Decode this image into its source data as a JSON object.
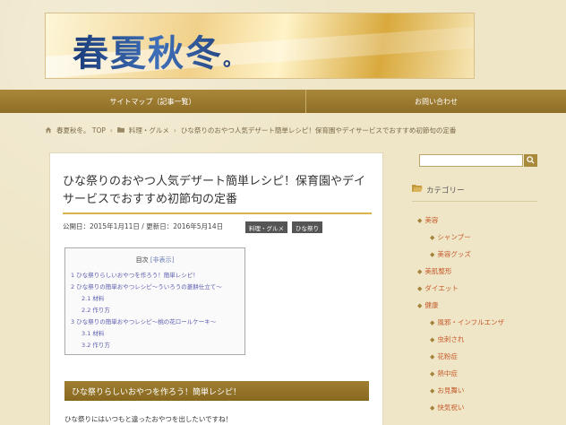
{
  "header": {
    "site_title": "春夏秋冬",
    "title_mark": "。"
  },
  "nav": {
    "items": [
      {
        "label": "サイトマップ（記事一覧）"
      },
      {
        "label": "お問い合わせ"
      }
    ]
  },
  "breadcrumb": {
    "home": "春夏秋冬。 TOP",
    "category": "料理・グルメ",
    "current": "ひな祭りのおやつ人気デザート簡単レシピ！保育園やデイサービスでおすすめ初節句の定番",
    "separator": "›"
  },
  "article": {
    "title": "ひな祭りのおやつ人気デザート簡単レシピ！保育園やデイサービスでおすすめ初節句の定番",
    "meta": "公開日：2015年1月11日 / 更新日：2016年5月14日",
    "tags": [
      "料理・グルメ",
      "ひな祭り"
    ],
    "toc": {
      "heading": "目次",
      "toggle": "[非表示]",
      "items": [
        {
          "text": "1 ひな祭りらしいおやつを作ろう！簡単レシピ！",
          "level": 1
        },
        {
          "text": "2 ひな祭りの簡単おやつレシピ〜ういろうの菱餅仕立て〜",
          "level": 1
        },
        {
          "text": "2.1 材料",
          "level": 2
        },
        {
          "text": "2.2 作り方",
          "level": 2
        },
        {
          "text": "3 ひな祭りの簡単おやつレシピ〜桃の花ロールケーキ〜",
          "level": 1
        },
        {
          "text": "3.1 材料",
          "level": 2
        },
        {
          "text": "3.2 作り方",
          "level": 2
        }
      ]
    },
    "section_heading": "ひな祭りらしいおやつを作ろう！簡単レシピ！",
    "section_text": "ひな祭りにはいつもと違ったおやつを出したいですね！"
  },
  "sidebar": {
    "search_placeholder": "",
    "category_title": "カテゴリー",
    "categories": [
      {
        "label": "美容",
        "sub": false
      },
      {
        "label": "シャンプー",
        "sub": true
      },
      {
        "label": "美容グッズ",
        "sub": true
      },
      {
        "label": "美肌整形",
        "sub": false
      },
      {
        "label": "ダイエット",
        "sub": false
      },
      {
        "label": "健康",
        "sub": false
      },
      {
        "label": "風邪・インフルエンザ",
        "sub": true
      },
      {
        "label": "虫刺され",
        "sub": true
      },
      {
        "label": "花粉症",
        "sub": true
      },
      {
        "label": "熱中症",
        "sub": true
      },
      {
        "label": "お見舞い",
        "sub": true
      },
      {
        "label": "快気祝い",
        "sub": true
      }
    ]
  },
  "colors": {
    "accent": "#9a7a2e",
    "link": "#c55a2a",
    "toc_link": "#5b5bb0"
  }
}
